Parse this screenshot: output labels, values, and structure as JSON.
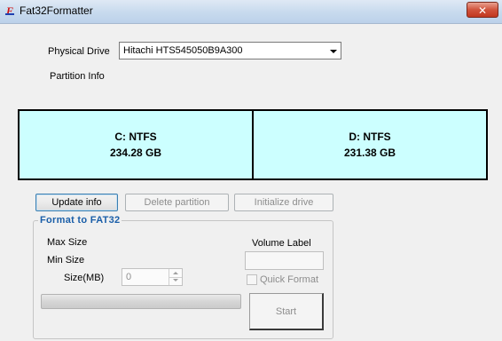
{
  "window": {
    "title": "Fat32Formatter",
    "close_label": "✕"
  },
  "drive": {
    "label": "Physical Drive",
    "selected": "Hitachi HTS545050B9A300",
    "partition_info_label": "Partition Info"
  },
  "partitions": [
    {
      "name": "C: NTFS",
      "size": "234.28 GB"
    },
    {
      "name": "D: NTFS",
      "size": "231.38 GB"
    }
  ],
  "actions": {
    "update_info": "Update info",
    "delete_partition": "Delete partition",
    "initialize_drive": "Initialize drive"
  },
  "format": {
    "group_title": "Format to FAT32",
    "max_size_label": "Max Size",
    "min_size_label": "Min Size",
    "size_label": "Size(MB)",
    "size_value": "0",
    "volume_label": "Volume Label",
    "volume_value": "",
    "quick_format_label": "Quick Format",
    "quick_format_checked": false,
    "progress": 0,
    "start_label": "Start"
  },
  "colors": {
    "partition_fill": "#ccffff",
    "group_title": "#1a5ea8",
    "close_button": "#c2371f"
  }
}
